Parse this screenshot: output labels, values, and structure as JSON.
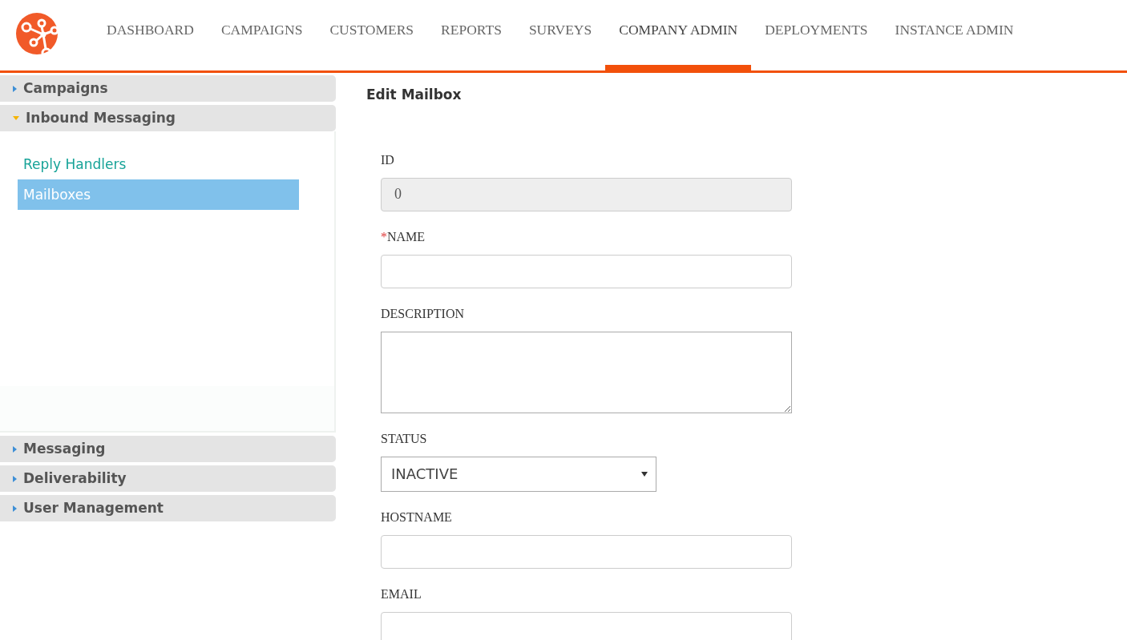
{
  "nav": [
    {
      "label": "DASHBOARD",
      "selected": false
    },
    {
      "label": "CAMPAIGNS",
      "selected": false
    },
    {
      "label": "CUSTOMERS",
      "selected": false
    },
    {
      "label": "REPORTS",
      "selected": false
    },
    {
      "label": "SURVEYS",
      "selected": false
    },
    {
      "label": "COMPANY ADMIN",
      "selected": true
    },
    {
      "label": "DEPLOYMENTS",
      "selected": false
    },
    {
      "label": "INSTANCE ADMIN",
      "selected": false
    }
  ],
  "sidebar": {
    "sections": [
      {
        "title": "Campaigns",
        "expanded": false
      },
      {
        "title": "Inbound Messaging",
        "expanded": true,
        "items": [
          {
            "label": "Reply Handlers",
            "selected": false
          },
          {
            "label": "Mailboxes",
            "selected": true
          }
        ]
      },
      {
        "title": "Messaging",
        "expanded": false
      },
      {
        "title": "Deliverability",
        "expanded": false
      },
      {
        "title": "User Management",
        "expanded": false
      }
    ]
  },
  "form": {
    "title": "Edit Mailbox",
    "fields": [
      {
        "kind": "text",
        "label": "ID",
        "value": "0",
        "disabled": true
      },
      {
        "kind": "text",
        "label": "NAME",
        "required_mark": "*",
        "disabled": false
      },
      {
        "kind": "textarea",
        "label": "DESCRIPTION"
      },
      {
        "kind": "select",
        "label": "STATUS",
        "value": "INACTIVE"
      },
      {
        "kind": "text",
        "label": "HOSTNAME",
        "disabled": false
      },
      {
        "kind": "text",
        "label": "EMAIL",
        "disabled": false
      }
    ]
  }
}
